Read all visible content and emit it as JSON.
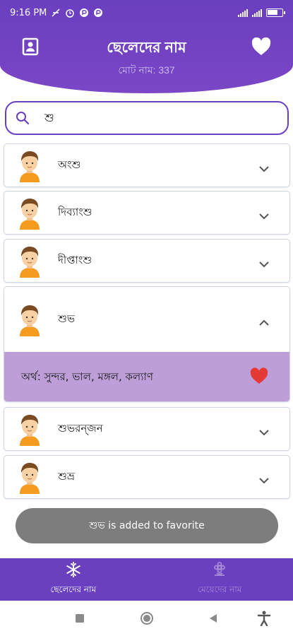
{
  "status_bar": {
    "time": "9:16 PM",
    "battery_level": 0.6
  },
  "header": {
    "title": "ছেলেদের নাম",
    "subtitle": "মোট নাম: 337",
    "left_icon": "contact-card-icon",
    "right_icon": "heart-icon"
  },
  "search": {
    "value": "শু",
    "icon": "search-icon"
  },
  "names": [
    {
      "name": "অংশু",
      "expanded": false
    },
    {
      "name": "দিব্যাংশু",
      "expanded": false
    },
    {
      "name": "দীপ্তাংশু",
      "expanded": false
    },
    {
      "name": "শুভ",
      "expanded": true,
      "meaning": "অর্থ: সুন্দর, ভাল, মঙ্গল, কল্যাণ"
    },
    {
      "name": "শুভরন্জন",
      "expanded": false
    },
    {
      "name": "শুভ্র",
      "expanded": false
    }
  ],
  "toast": {
    "text": "শুভ is added to favorite"
  },
  "bottom_nav": {
    "items": [
      {
        "label": "ছেলেদের নাম",
        "icon": "snowflake-icon",
        "active": true
      },
      {
        "label": "মেয়েদের নাম",
        "icon": "flower-icon",
        "active": false
      }
    ]
  },
  "colors": {
    "primary": "#6a3fc0",
    "expanded_bg": "#bd9ed8",
    "heart": "#e53935",
    "toast_bg": "#7d7d7d"
  }
}
